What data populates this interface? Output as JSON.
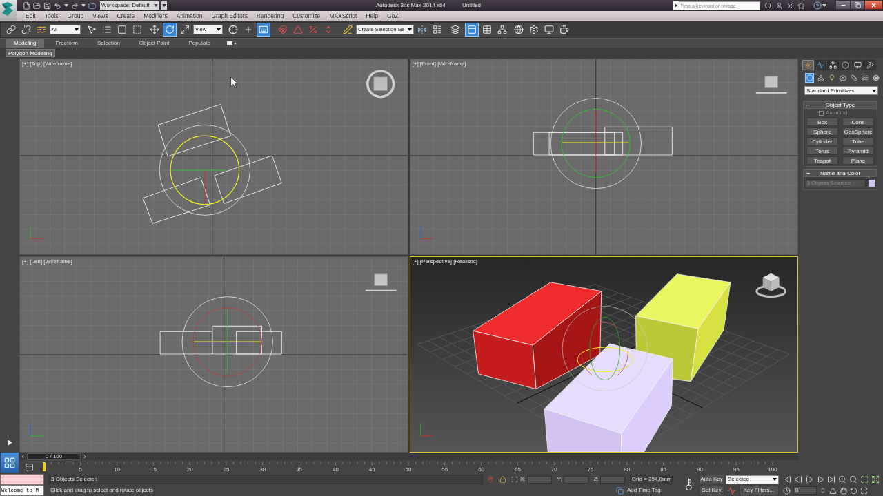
{
  "title_bar": {
    "workspace": "Workspace: Default",
    "title": "Autodesk 3ds Max 2014 x64",
    "document": "Untitled",
    "search": {
      "placeholder": "Type a keyword or phrase"
    }
  },
  "menu_bar": [
    "Edit",
    "Tools",
    "Group",
    "Views",
    "Create",
    "Modifiers",
    "Animation",
    "Graph Editors",
    "Rendering",
    "Customize",
    "MAXScript",
    "Help",
    "GoZ"
  ],
  "main_toolbar": [
    {
      "kind": "button",
      "selected": false
    },
    {
      "kind": "button",
      "selected": false
    },
    {
      "kind": "button",
      "selected": false
    },
    {
      "kind": "dropdown",
      "value": "All"
    },
    {
      "kind": "button",
      "selected": false
    },
    {
      "kind": "button",
      "selected": false
    },
    {
      "kind": "button",
      "selected": false
    },
    {
      "kind": "button",
      "selected": false
    },
    {
      "kind": "button",
      "selected": false
    },
    {
      "kind": "button",
      "selected": true
    },
    {
      "kind": "button",
      "selected": false
    },
    {
      "kind": "dropdown",
      "value": "View"
    },
    {
      "kind": "button",
      "selected": false
    },
    {
      "kind": "button",
      "selected": false
    },
    {
      "kind": "button",
      "selected": true
    },
    {
      "kind": "button",
      "selected": false
    },
    {
      "kind": "button",
      "selected": false
    },
    {
      "kind": "button",
      "selected": false
    },
    {
      "kind": "button",
      "selected": false
    },
    {
      "kind": "button",
      "selected": false
    },
    {
      "kind": "dropdown",
      "value": "Create Selection Se"
    },
    {
      "kind": "button",
      "selected": false
    },
    {
      "kind": "button",
      "selected": false
    },
    {
      "kind": "button",
      "selected": false
    },
    {
      "kind": "button",
      "selected": true
    },
    {
      "kind": "button",
      "selected": false
    },
    {
      "kind": "button",
      "selected": false
    },
    {
      "kind": "button",
      "selected": false
    },
    {
      "kind": "button",
      "selected": false
    },
    {
      "kind": "button",
      "selected": false
    },
    {
      "kind": "button",
      "selected": false
    }
  ],
  "ribbon": {
    "tabs": [
      {
        "label": "Modeling",
        "selected": true
      },
      {
        "label": "Freeform",
        "selected": false
      },
      {
        "label": "Selection",
        "selected": false
      },
      {
        "label": "Object Paint",
        "selected": false
      },
      {
        "label": "Populate",
        "selected": false
      }
    ],
    "panel": "Polygon Modeling"
  },
  "viewports": [
    {
      "label": "[+] [Top] [Wireframe]",
      "kind": "top",
      "selected": false
    },
    {
      "label": "[+] [Front] [Wireframe]",
      "kind": "front",
      "selected": false
    },
    {
      "label": "[+] [Left] [Wireframe]",
      "kind": "left",
      "selected": false
    },
    {
      "label": "[+] [Perspective] [Realistic]",
      "kind": "perspective",
      "selected": true
    }
  ],
  "command_panel": {
    "tabs": [
      {
        "selected": true
      },
      {
        "selected": false
      },
      {
        "selected": false
      },
      {
        "selected": false
      },
      {
        "selected": false
      },
      {
        "selected": false
      }
    ],
    "categories": [
      {
        "selected": true
      },
      {
        "selected": false
      },
      {
        "selected": false
      },
      {
        "selected": false
      },
      {
        "selected": false
      },
      {
        "selected": false
      },
      {
        "selected": false
      }
    ],
    "category_dropdown": "Standard Primitives",
    "object_type": {
      "title": "Object Type",
      "expanded": true,
      "autogrid": {
        "label": "AutoGrid",
        "checked": false,
        "disabled": true
      },
      "buttons": [
        "Box",
        "Cone",
        "Sphere",
        "GeoSphere",
        "Cylinder",
        "Tube",
        "Torus",
        "Pyramid",
        "Teapot",
        "Plane"
      ]
    },
    "name_and_color": {
      "title": "Name and Color",
      "expanded": true,
      "name": "3 Objects Selected",
      "color": "#cfc2f2"
    }
  },
  "time_slider": {
    "label": "0 / 100",
    "level": 0
  },
  "track_bar": {
    "labels": [
      "5",
      "10",
      "15",
      "20",
      "25",
      "30",
      "35",
      "40",
      "45",
      "50",
      "55",
      "60",
      "65",
      "70",
      "75",
      "80",
      "85",
      "90",
      "95",
      "100"
    ]
  },
  "status_bar": {
    "listener_output": "Welcome to M",
    "selection": "3 Objects Selected",
    "prompt": "Click and drag to select and rotate objects",
    "coordinates": [
      "X:",
      "Y:",
      "Z:"
    ],
    "grid": "Grid = 254,0mm",
    "time_tag": "Add Time Tag"
  },
  "animation_controls": {
    "auto_key": "Auto Key",
    "key_set": "Selectec",
    "set_key": "Set Key",
    "key_filters": "Key Filters...",
    "frame": "0"
  }
}
